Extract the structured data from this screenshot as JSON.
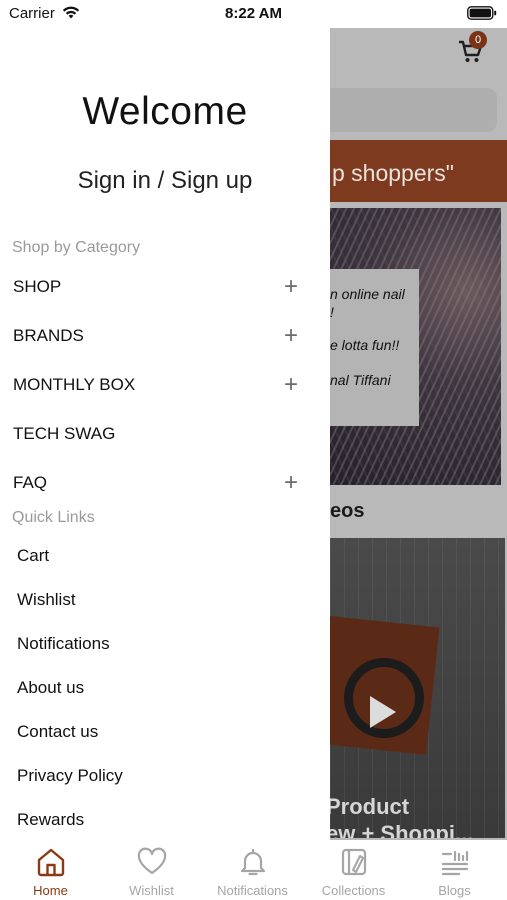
{
  "status_bar": {
    "carrier": "Carrier",
    "time": "8:22 AM"
  },
  "background_page": {
    "cart_count": "0",
    "banner_text": "p shoppers\"",
    "quote_lines": [
      "n online nail",
      "!",
      "e lotta fun!!",
      "nal Tiffani"
    ],
    "videos_heading": "eos",
    "video_title_line1": "Product",
    "video_title_line2": "ew + Shoppi..."
  },
  "drawer": {
    "welcome": "Welcome",
    "signin": "Sign in / Sign up",
    "shop_by_category_label": "Shop by Category",
    "categories": [
      {
        "label": "SHOP",
        "expandable": true
      },
      {
        "label": "BRANDS",
        "expandable": true
      },
      {
        "label": "MONTHLY BOX",
        "expandable": true
      },
      {
        "label": "TECH SWAG",
        "expandable": false
      },
      {
        "label": "FAQ",
        "expandable": true
      }
    ],
    "expand_symbol": "+",
    "quick_links_label": "Quick Links",
    "quick_links": [
      "Cart",
      "Wishlist",
      "Notifications",
      "About us",
      "Contact us",
      "Privacy Policy",
      "Rewards"
    ]
  },
  "tabbar": {
    "active_color": "#8a3a12",
    "inactive_color": "#a5a5a5",
    "tabs": [
      {
        "label": "Home",
        "icon": "home-icon",
        "active": true
      },
      {
        "label": "Wishlist",
        "icon": "heart-icon",
        "active": false
      },
      {
        "label": "Notifications",
        "icon": "bell-icon",
        "active": false
      },
      {
        "label": "Collections",
        "icon": "collections-icon",
        "active": false
      },
      {
        "label": "Blogs",
        "icon": "blogs-icon",
        "active": false
      }
    ]
  }
}
